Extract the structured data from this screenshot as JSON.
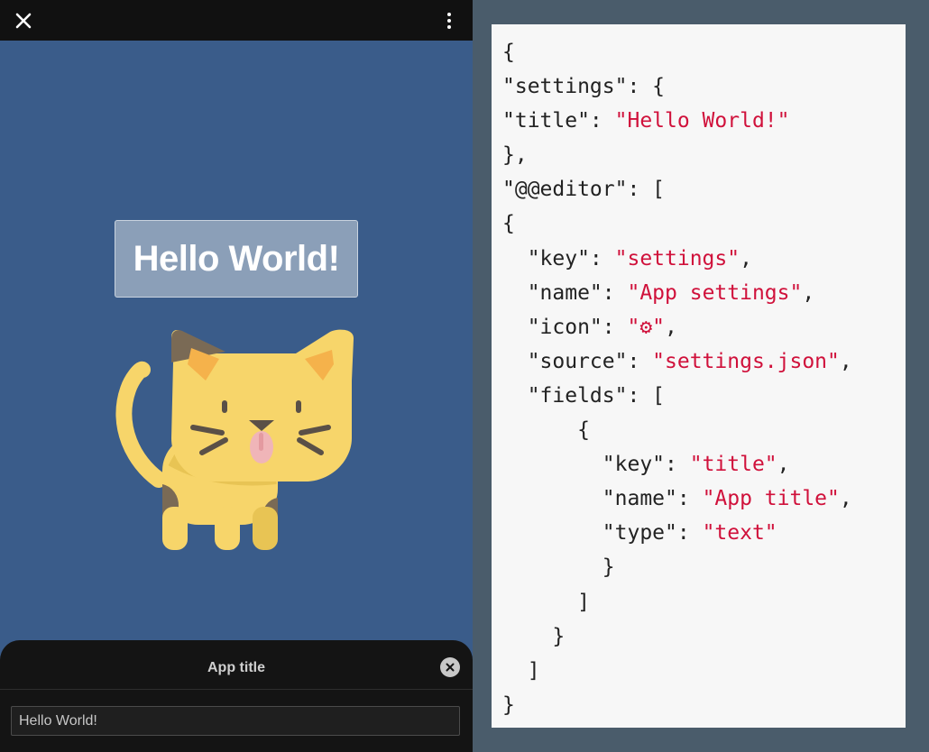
{
  "app": {
    "hello_text": "Hello World!",
    "close_icon": "close-icon",
    "menu_icon": "kebab-menu-icon"
  },
  "sheet": {
    "title": "App title",
    "input_value": "Hello World!"
  },
  "code": {
    "l1": "{",
    "l2": "\"settings\": {",
    "l3_key": "\"title\": ",
    "l3_val": "\"Hello World!\"",
    "l4": "},",
    "l5": "\"@@editor\": [",
    "l6": "{",
    "l7_key": "  \"key\": ",
    "l7_val": "\"settings\"",
    "l7_end": ",",
    "l8_key": "  \"name\": ",
    "l8_val": "\"App settings\"",
    "l8_end": ",",
    "l9_key": "  \"icon\": ",
    "l9_val": "\"⚙\"",
    "l9_end": ",",
    "l10_key": "  \"source\": ",
    "l10_val": "\"settings.json\"",
    "l10_end": ",",
    "l11": "  \"fields\": [",
    "l12": "      {",
    "l13_key": "        \"key\": ",
    "l13_val": "\"title\"",
    "l13_end": ",",
    "l14_key": "        \"name\": ",
    "l14_val": "\"App title\"",
    "l14_end": ",",
    "l15_key": "        \"type\": ",
    "l15_val": "\"text\"",
    "l16": "        }",
    "l17": "      ]",
    "l18": "    }",
    "l19": "  ]",
    "l20": "}"
  }
}
